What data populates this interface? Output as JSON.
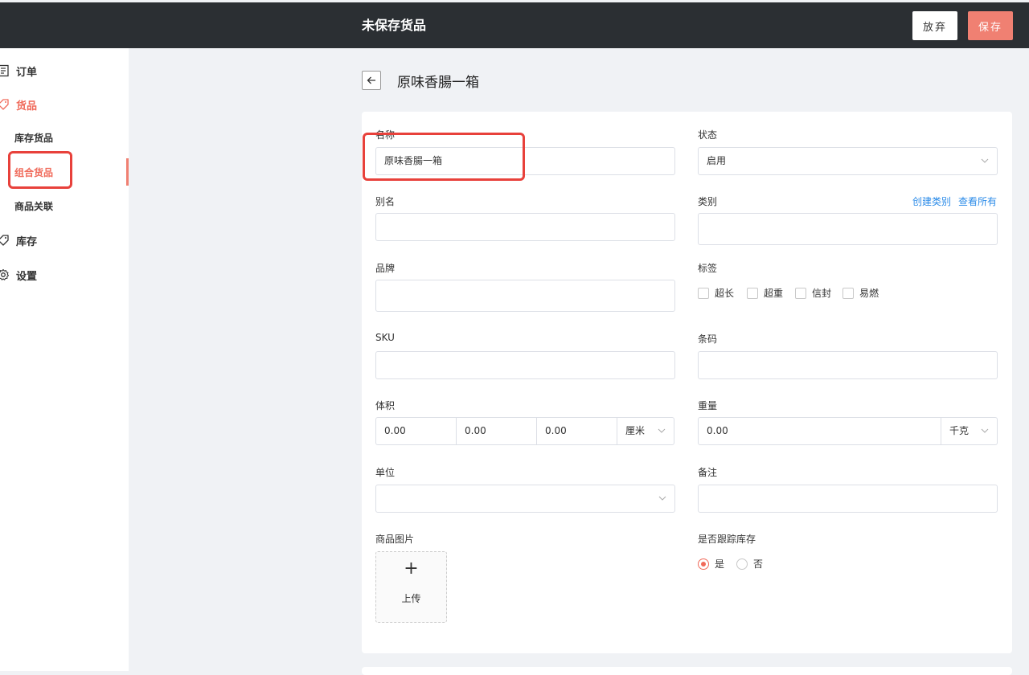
{
  "topbar": {
    "title": "未保存货品",
    "discard_label": "放弃",
    "save_label": "保存"
  },
  "sidebar": {
    "items": [
      {
        "label": "订单",
        "icon": "order-icon"
      },
      {
        "label": "货品",
        "icon": "tag-icon"
      },
      {
        "label": "库存",
        "icon": "tag-icon"
      },
      {
        "label": "设置",
        "icon": "gear-icon"
      }
    ],
    "sub_items": [
      "库存货品",
      "组合货品",
      "商品关联"
    ]
  },
  "page": {
    "title": "原味香腸一箱"
  },
  "form": {
    "name": {
      "label": "名称",
      "value": "原味香腸一箱"
    },
    "status": {
      "label": "状态",
      "value": "启用"
    },
    "alias": {
      "label": "别名",
      "value": ""
    },
    "category": {
      "label": "类别",
      "value": "",
      "create_link": "创建类别",
      "view_all_link": "查看所有"
    },
    "brand": {
      "label": "品牌",
      "value": ""
    },
    "tags": {
      "label": "标签",
      "options": [
        "超长",
        "超重",
        "信封",
        "易燃"
      ]
    },
    "sku": {
      "label": "SKU",
      "value": ""
    },
    "barcode": {
      "label": "条码",
      "value": ""
    },
    "volume": {
      "label": "体积",
      "length": "0.00",
      "width": "0.00",
      "height": "0.00",
      "unit": "厘米"
    },
    "weight": {
      "label": "重量",
      "value": "0.00",
      "unit": "千克"
    },
    "unit": {
      "label": "单位",
      "value": ""
    },
    "remark": {
      "label": "备注",
      "value": ""
    },
    "image": {
      "label": "商品图片",
      "upload_label": "上传"
    },
    "track_inventory": {
      "label": "是否跟踪库存",
      "yes": "是",
      "no": "否",
      "selected": "是"
    }
  },
  "colors": {
    "accent": "#f06a5a",
    "topbar": "#2b2f33",
    "link": "#2b8be8"
  }
}
